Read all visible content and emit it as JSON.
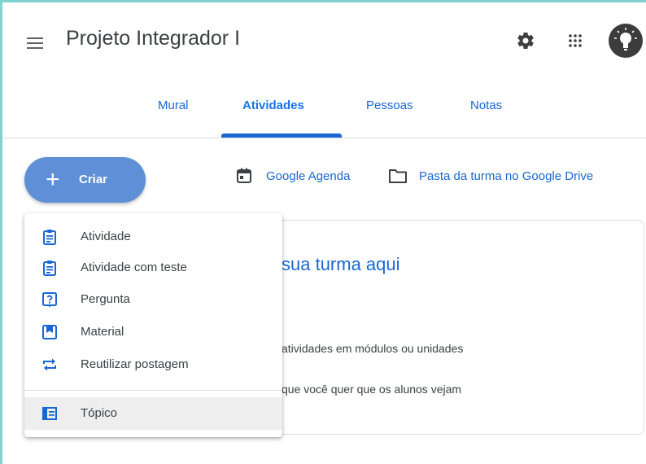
{
  "header": {
    "title": "Projeto Integrador I",
    "icons": {
      "menu": "menu-icon",
      "settings": "gear-icon",
      "apps": "apps-grid-icon",
      "avatar": "lightbulb-avatar"
    }
  },
  "tabs": [
    {
      "label": "Mural"
    },
    {
      "label": "Atividades",
      "active": true
    },
    {
      "label": "Pessoas"
    },
    {
      "label": "Notas"
    }
  ],
  "actions": {
    "create_label": "Criar",
    "calendar_label": "Google Agenda",
    "drive_label": "Pasta da turma no Google Drive"
  },
  "background_card": {
    "title": "sua turma aqui",
    "line1": "atividades em módulos ou unidades",
    "line2": "que você quer que os alunos vejam"
  },
  "create_menu": {
    "items": [
      {
        "label": "Atividade",
        "icon": "assignment-icon"
      },
      {
        "label": "Atividade com teste",
        "icon": "quiz-assignment-icon"
      },
      {
        "label": "Pergunta",
        "icon": "question-icon"
      },
      {
        "label": "Material",
        "icon": "material-icon"
      },
      {
        "label": "Reutilizar postagem",
        "icon": "repeat-icon"
      }
    ],
    "topic": {
      "label": "Tópico",
      "icon": "topic-list-icon"
    }
  },
  "colors": {
    "accent": "#1967d2",
    "create_button": "#5f8fd6",
    "frame": "#7fd3cf"
  }
}
